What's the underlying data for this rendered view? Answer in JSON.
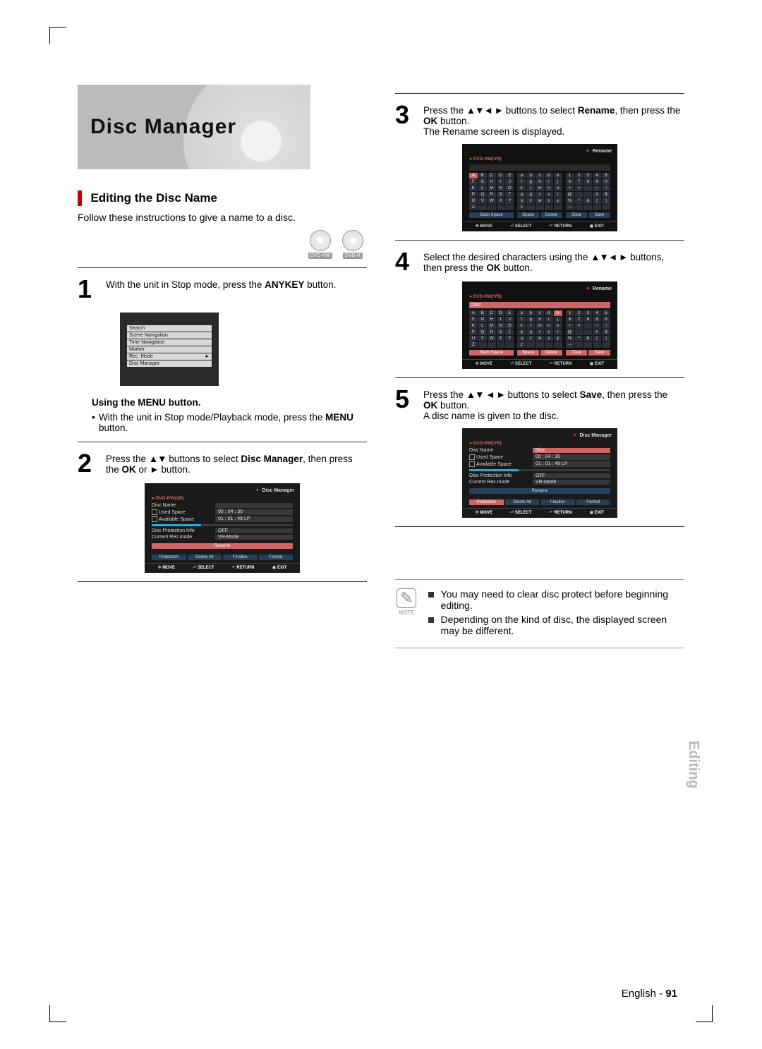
{
  "header": {
    "title": "Disc Manager"
  },
  "section": {
    "title": "Editing the Disc Name",
    "intro": "Follow these instructions to give a name to a disc."
  },
  "dvd_icons": [
    "DVD-RW",
    "DVD-R"
  ],
  "step1": {
    "num": "1",
    "text_pre": "With the unit in Stop mode, press the ",
    "anykey": "ANYKEY",
    "text_post": " button."
  },
  "osd_menu": {
    "items": [
      "Search",
      "Scene Navigation",
      "Time Navigation",
      "Marker",
      "Rec. Mode",
      "Disc Manager"
    ],
    "arrow": "►"
  },
  "using_menu": {
    "title": "Using the MENU button.",
    "line_pre": "With the unit in Stop mode/Playback mode, press the ",
    "menu": "MENU",
    "line_post": " button."
  },
  "step2": {
    "num": "2",
    "pre": "Press the ",
    "arrows": "▲▼",
    "mid": " buttons to select ",
    "label": "Disc Manager",
    "mid2": ", then press the ",
    "ok": "OK",
    "mid3": " or ",
    "arrow2": "►",
    "post": " button."
  },
  "osd_dm": {
    "title": "Disc Manager",
    "media": "DVD-RW(VR)",
    "disc_name_lbl": "Disc Name",
    "disc_name_val": "",
    "used_lbl": "Used Space",
    "used_val": "00 : 04 : 30",
    "avail_lbl": "Available Space",
    "avail_val": "01 : 01 : 48 LP",
    "prot_lbl": "Disc Protection Info",
    "prot_val": "OFF",
    "rec_lbl": "Current Rec.mode",
    "rec_val": "VR-Mode",
    "buttons": [
      "Rename",
      "Protection",
      "Delete All",
      "Finalise",
      "Format"
    ],
    "sel_button": "Rename",
    "foot": {
      "move": "MOVE",
      "select": "SELECT",
      "return": "RETURN",
      "exit": "EXIT"
    }
  },
  "step3": {
    "num": "3",
    "pre": "Press the ",
    "arrows": "▲▼◄ ►",
    "mid": " buttons to select ",
    "label": "Rename",
    "mid2": ", then press the ",
    "ok": "OK",
    "mid3": " button.",
    "post": "The Rename screen is displayed."
  },
  "osd_kb_common": {
    "title": "Rename",
    "media": "DVD-RW(VR)",
    "upper": [
      "A",
      "B",
      "C",
      "D",
      "E",
      "F",
      "G",
      "H",
      "I",
      "J",
      "K",
      "L",
      "M",
      "N",
      "O",
      "P",
      "Q",
      "R",
      "S",
      "T",
      "U",
      "V",
      "W",
      "X",
      "Y",
      "Z",
      "",
      "",
      "",
      ""
    ],
    "lower": [
      "a",
      "b",
      "c",
      "d",
      "e",
      "f",
      "g",
      "h",
      "i",
      "j",
      "k",
      "l",
      "m",
      "n",
      "o",
      "p",
      "q",
      "r",
      "s",
      "t",
      "u",
      "v",
      "w",
      "x",
      "y",
      "z",
      "",
      "",
      "",
      ""
    ],
    "nums": [
      "1",
      "2",
      "3",
      "4",
      "5",
      "6",
      "7",
      "8",
      "9",
      "0",
      "+",
      "=",
      ".",
      "~",
      "!",
      "@",
      "",
      "",
      "#",
      "$",
      "%",
      "^",
      "&",
      "(",
      ")",
      "–",
      "",
      "",
      "",
      ""
    ],
    "backspace": "Back Space",
    "space": "Space",
    "delete": "Delete",
    "clear": "Clear",
    "save": "Save",
    "foot": {
      "move": "MOVE",
      "select": "SELECT",
      "return": "RETURN",
      "exit": "EXIT"
    }
  },
  "osd_kb1": {
    "sel_cell": "A",
    "field": ""
  },
  "osd_kb2": {
    "sel_cell": "e",
    "field": "Disc "
  },
  "step4": {
    "num": "4",
    "pre": "Select the desired characters using the ",
    "arrows": "▲▼◄ ►",
    "mid": " buttons, then press the ",
    "ok": "OK",
    "post": " button."
  },
  "step5": {
    "num": "5",
    "pre": "Press the ",
    "arrows": "▲▼ ◄ ►",
    "mid": " buttons to select ",
    "label": "Save",
    "mid2": ", then press the ",
    "ok": "OK",
    "mid3": " button.",
    "post": "A disc name is given to the disc."
  },
  "osd_dm2": {
    "disc_name_val": "Disc",
    "sel_button": "Protection"
  },
  "note": {
    "label": "NOTE",
    "items": [
      "You may need to clear disc protect before beginning editing.",
      "Depending on the kind of disc, the displayed screen may be different."
    ]
  },
  "side_tab": "Editing",
  "footer": {
    "lang": "English",
    "sep": " - ",
    "page": "91"
  }
}
